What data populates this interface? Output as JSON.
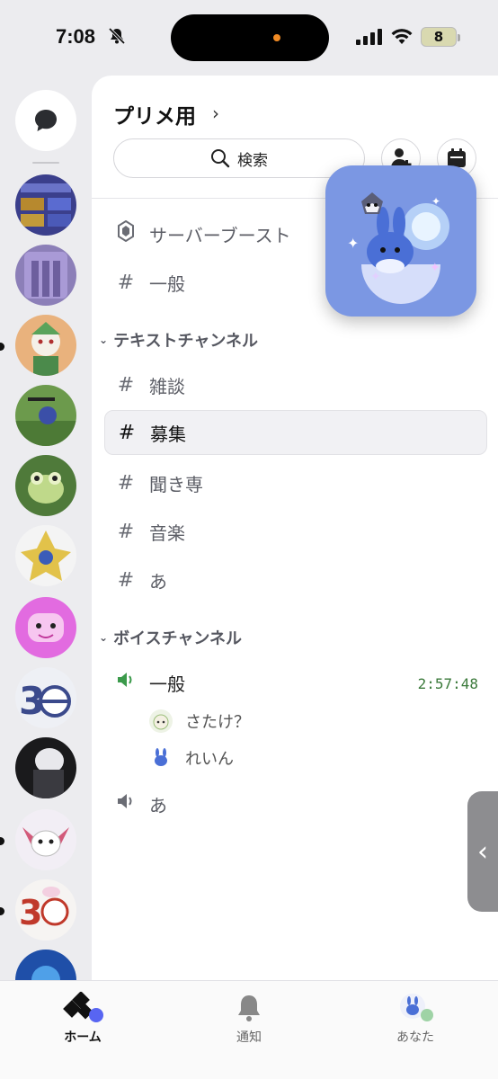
{
  "status_bar": {
    "time": "7:08",
    "battery": "8"
  },
  "server": {
    "name": "プリメ用"
  },
  "search": {
    "label": "検索"
  },
  "channels": {
    "boost": "サーバーブースト",
    "general": "一般",
    "text_category": "テキストチャンネル",
    "text": [
      "雑談",
      "募集",
      "聞き専",
      "音楽",
      "あ"
    ],
    "voice_category": "ボイスチャンネル",
    "voice_general": "一般",
    "voice_timer": "2:57:48",
    "voice_users": [
      "さたけ？",
      "れいん"
    ],
    "voice_a": "あ"
  },
  "tabs": {
    "home": "ホーム",
    "notifications": "通知",
    "you": "あなた"
  },
  "colors": {
    "accent": "#5865f2",
    "voice_green": "#3b7a3b",
    "float_bg": "#7b97e3"
  },
  "icons": [
    "chat-bubble-icon",
    "search-icon",
    "add-member-icon",
    "calendar-icon",
    "boost-icon",
    "hash-icon",
    "speaker-icon",
    "bell-icon",
    "chevron-left-icon"
  ]
}
